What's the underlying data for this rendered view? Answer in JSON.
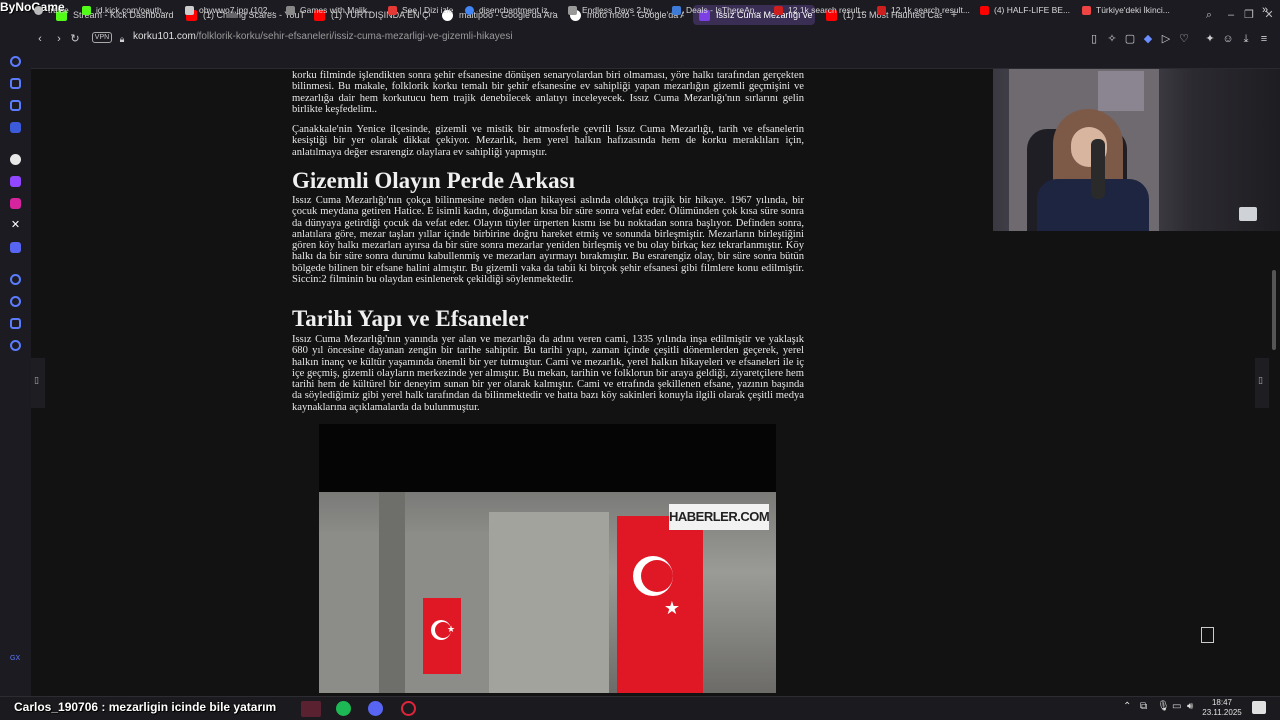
{
  "brand": "ByNoGame",
  "tabs": [
    {
      "label": "Stream - Kick Dashboard",
      "color": "#53fc18"
    },
    {
      "label": "(1) Chilling Scares - YouT",
      "color": "#ff0000"
    },
    {
      "label": "(1) YURTDIŞINDA EN ÇOK",
      "color": "#ff0000"
    },
    {
      "label": "maltipoo - Google'da Ara",
      "color": "#ffffff"
    },
    {
      "label": "moto moto - Google'da A",
      "color": "#ffffff"
    },
    {
      "label": "Issız Cuma Mezarlığı ve G",
      "color": "#7b3fe4"
    },
    {
      "label": "(1) 15 Most Haunted Castl",
      "color": "#ff0000"
    }
  ],
  "address": {
    "vpn": "VPN",
    "domain": "korku101.com",
    "path": "/folklorik-korku/sehir-efsaneleri/issiz-cuma-mezarligi-ve-gizemli-hikayesi"
  },
  "bookmarks": [
    {
      "label": "travle",
      "color": "#bbbbbb"
    },
    {
      "label": "id.kick.com/oauth...",
      "color": "#53fc18"
    },
    {
      "label": "obywwo7.jpg (102...",
      "color": "#cccccc"
    },
    {
      "label": "Games with Malik...",
      "color": "#888888"
    },
    {
      "label": "See | Dizi izle",
      "color": "#e53935"
    },
    {
      "label": "disenchantment iz...",
      "color": "#4285f4"
    },
    {
      "label": "Endless Days 2 by...",
      "color": "#999999"
    },
    {
      "label": "Deals - IsThereAn...",
      "color": "#3d7bd6"
    },
    {
      "label": "12.1k search result...",
      "color": "#cf1e1e"
    },
    {
      "label": "12.1k search result...",
      "color": "#cf1e1e"
    },
    {
      "label": "(4) HALF-LIFE BE...",
      "color": "#ff0000"
    },
    {
      "label": "Türkiye'deki İkinci...",
      "color": "#e44"
    }
  ],
  "article": {
    "intro1": "korku filminde işlendikten sonra şehir efsanesine dönüşen senaryolardan biri olmaması, yöre halkı tarafından gerçekten bilinmesi. Bu makale, folklorik korku temalı bir şehir efsanesine ev sahipliği yapan mezarlığın gizemli geçmişini ve mezarlığa dair hem korkutucu hem trajik denebilecek anlatıyı inceleyecek. Issız Cuma Mezarlığı'nın sırlarını gelin birlikte keşfedelim..",
    "intro2": "Çanakkale'nin Yenice ilçesinde, gizemli ve mistik bir atmosferle çevrili Issız Cuma Mezarlığı, tarih ve efsanelerin kesiştiği bir yer olarak dikkat çekiyor. Mezarlık, hem yerel halkın hafızasında hem de korku meraklıları için, anlatılmaya değer esrarengiz olaylara ev sahipliği yapmıştır.",
    "h2_1": "Gizemli Olayın Perde Arkası",
    "body1": "Issız Cuma Mezarlığı'nın çokça bilinmesine neden olan hikayesi aslında oldukça trajik bir hikaye. 1967 yılında, bir çocuk meydana getiren Hatice. E isimli kadın, doğumdan kısa bir süre sonra vefat eder. Ölümünden çok kısa süre sonra da dünyaya getirdiği çocuk da vefat eder. Olayın tüyler ürperten kısmı ise bu noktadan sonra başlıyor. Definden sonra, anlatılara göre, mezar taşları yıllar içinde birbirine doğru hareket etmiş ve sonunda birleşmiştir. Mezarların birleştiğini gören köy halkı mezarları ayırsa da bir süre sonra mezarlar yeniden birleşmiş ve bu olay birkaç kez tekrarlanmıştır. Köy halkı da bir süre sonra durumu kabullenmiş ve mezarları ayırmayı bırakmıştır. Bu esrarengiz olay, bir süre sonra bütün bölgede bilinen bir efsane halini almıştır. Bu gizemli vaka da tabii ki birçok şehir efsanesi gibi filmlere konu edilmiştir. Siccin:2 filminin bu olaydan esinlenerek çekildiği söylenmektedir.",
    "h2_2": "Tarihi Yapı ve Efsaneler",
    "body2": "Issız Cuma Mezarlığı'nın yanında yer alan ve mezarlığa da adını veren cami, 1335 yılında inşa edilmiştir ve yaklaşık 680 yıl öncesine dayanan zengin bir tarihe sahiptir. Bu tarihi yapı, zaman içinde çeşitli dönemlerden geçerek, yerel halkın inanç ve kültür yaşamında önemli bir yer tutmuştur. Cami ve mezarlık, yerel halkın hikayeleri ve efsaneleri ile iç içe geçmiş, gizemli olayların merkezinde yer almıştır. Bu mekan, tarihin ve folklorun bir araya geldiği, ziyaretçilere hem tarihi hem de kültürel bir deneyim sunan bir yer olarak kalmıştır. Cami ve etrafında şekillenen efsane, yazının başında da söylediğimiz gibi yerel halk tarafından da bilinmektedir ve hatta bazı köy sakinleri konuyla ilgili olarak çeşitli medya kaynaklarına açıklamalarda da bulunmuştur."
  },
  "video": {
    "watermark": "HABERLER.COM"
  },
  "overlay": {
    "chat": "Carlos_190706 : mezarligin icinde bile yatarım",
    "side_label": "GX"
  },
  "clock": {
    "time": "18:47",
    "date": "23.11.2025"
  },
  "colors": {
    "accent": "#7b3fe4",
    "kick": "#53fc18",
    "flag_red": "#e01825"
  }
}
